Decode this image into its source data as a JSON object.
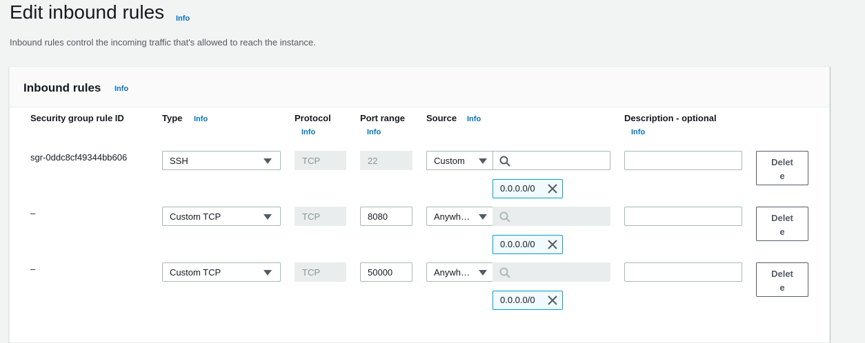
{
  "page": {
    "title": "Edit inbound rules",
    "title_info": "Info",
    "description": "Inbound rules control the incoming traffic that's allowed to reach the instance."
  },
  "panel": {
    "title": "Inbound rules",
    "info": "Info"
  },
  "columns": {
    "rule_id": "Security group rule ID",
    "type": "Type",
    "type_info": "Info",
    "protocol": "Protocol",
    "protocol_info": "Info",
    "port_range": "Port range",
    "port_range_info": "Info",
    "source": "Source",
    "source_info": "Info",
    "description": "Description - optional",
    "description_info": "Info"
  },
  "rules": [
    {
      "rule_id": "sgr-0ddc8cf49344bb606",
      "type": "SSH",
      "protocol": "TCP",
      "port_range": "22",
      "source_mode": "Custom",
      "source_search": "",
      "cidr": "0.0.0.0/0",
      "description": "",
      "delete_label": "Delete"
    },
    {
      "rule_id": "–",
      "type": "Custom TCP",
      "protocol": "TCP",
      "port_range": "8080",
      "source_mode": "Anywh…",
      "source_search": "",
      "cidr": "0.0.0.0/0",
      "description": "",
      "delete_label": "Delete"
    },
    {
      "rule_id": "–",
      "type": "Custom TCP",
      "protocol": "TCP",
      "port_range": "50000",
      "source_mode": "Anywh…",
      "source_search": "",
      "cidr": "0.0.0.0/0",
      "description": "",
      "delete_label": "Delete"
    }
  ],
  "colors": {
    "link": "#0073bb",
    "token_border": "#00a1c9",
    "token_bg": "#f1faff",
    "disabled_bg": "#eaeded"
  }
}
